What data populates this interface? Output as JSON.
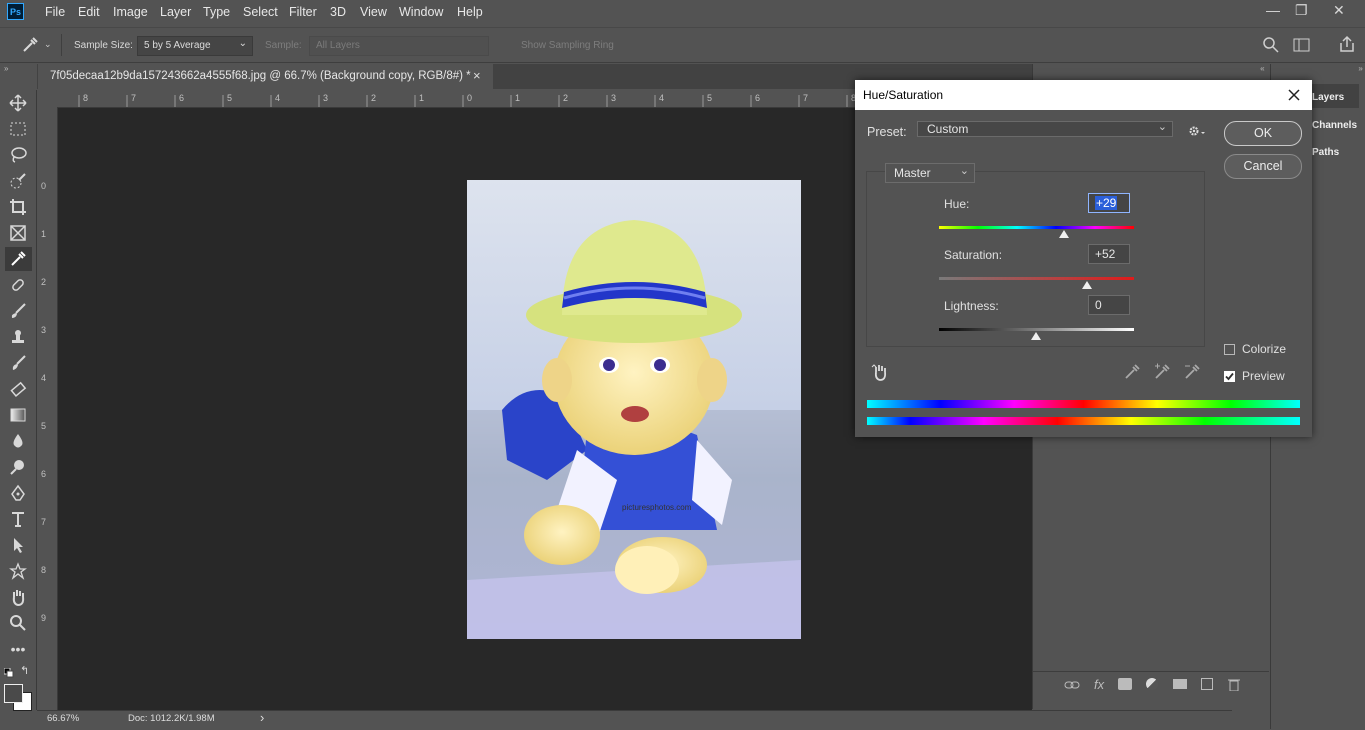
{
  "app": {
    "logo": "Ps"
  },
  "menu": [
    "File",
    "Edit",
    "Image",
    "Layer",
    "Type",
    "Select",
    "Filter",
    "3D",
    "View",
    "Window",
    "Help"
  ],
  "window_controls": {
    "minimize": "—",
    "restore": "❐",
    "close": "✕"
  },
  "options_bar": {
    "sample_size_label": "Sample Size:",
    "sample_size_value": "5 by 5 Average",
    "sample_label": "Sample:",
    "sample_value": "All Layers",
    "show_ring_label": "Show Sampling Ring"
  },
  "document": {
    "tab_title": "7f05decaa12b9da157243662a4555f68.jpg @ 66.7% (Background copy, RGB/8#) *",
    "close": "×"
  },
  "rulers": {
    "top": [
      "8",
      "7",
      "6",
      "5",
      "4",
      "3",
      "2",
      "1",
      "0",
      "1",
      "2",
      "3",
      "4",
      "5",
      "6",
      "7",
      "8"
    ],
    "left": [
      "0",
      "1",
      "2",
      "3",
      "4",
      "5",
      "6",
      "7",
      "8",
      "9"
    ]
  },
  "status": {
    "zoom": "66.67%",
    "doc": "Doc: 1012.2K/1.98M",
    "arrow": "›"
  },
  "panels": {
    "tabs": [
      "Layers",
      "Channels",
      "Paths"
    ]
  },
  "hue_saturation": {
    "title": "Hue/Saturation",
    "preset_label": "Preset:",
    "preset_value": "Custom",
    "ok": "OK",
    "cancel": "Cancel",
    "channel": "Master",
    "hue_label": "Hue:",
    "hue_value": "+29",
    "saturation_label": "Saturation:",
    "saturation_value": "+52",
    "lightness_label": "Lightness:",
    "lightness_value": "0",
    "colorize_label": "Colorize",
    "colorize_checked": false,
    "preview_label": "Preview",
    "preview_checked": true
  },
  "image": {
    "watermark": "picturesphotos.com"
  }
}
